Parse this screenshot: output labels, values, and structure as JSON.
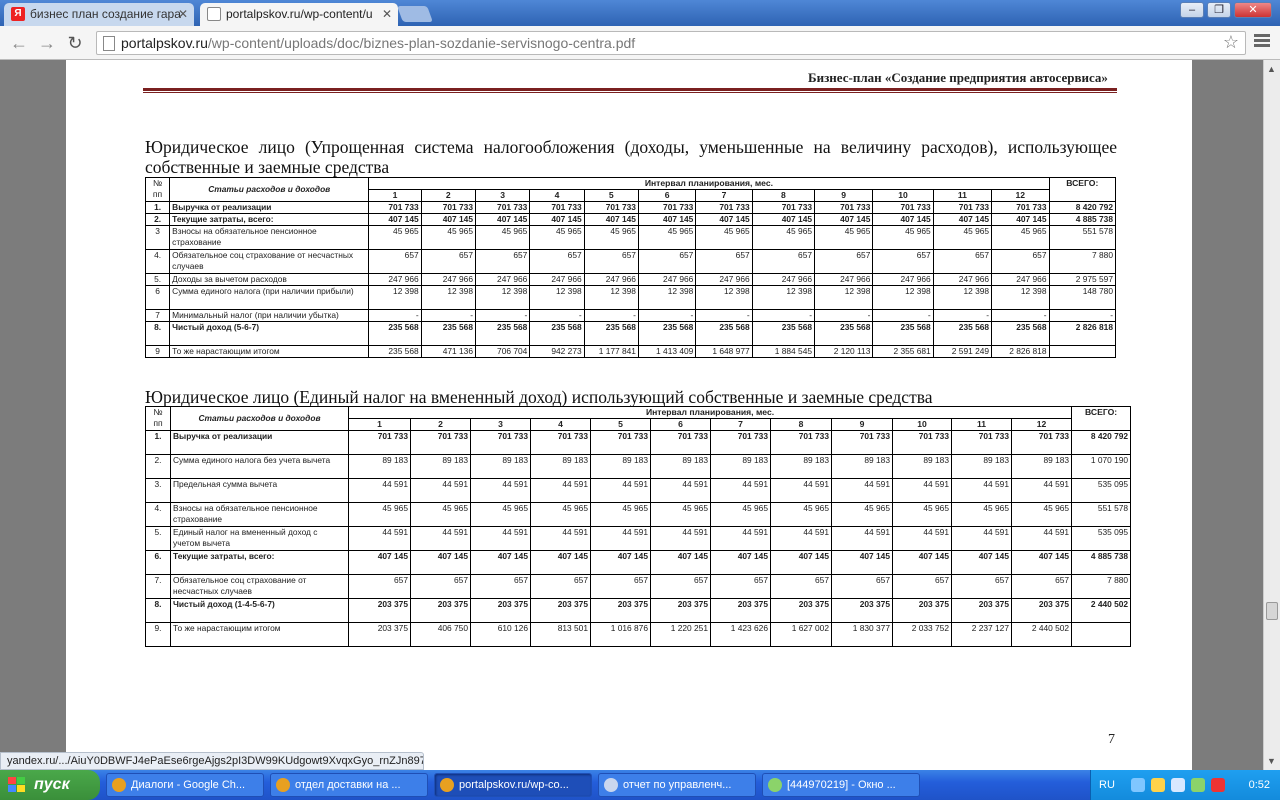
{
  "browser": {
    "tabs": [
      {
        "title": "бизнес план создание гара",
        "favicon": "Я",
        "active": false
      },
      {
        "title": "portalpskov.ru/wp-content/u",
        "favicon": "",
        "active": true
      }
    ],
    "url_host": "portalpskov.ru",
    "url_path": "/wp-content/uploads/doc/biznes-plan-sozdanie-servisnogo-centra.pdf",
    "status_text": "yandex.ru/.../AiuY0DBWFJ4ePaEse6rgeAjgs2pI3DW99KUdgowt9XvqxGyo_rnZJn897..."
  },
  "doc": {
    "header": "Бизнес-план «Создание предприятия автосервиса»",
    "page_number": "7",
    "section1_title": "Юридическое лицо (Упрощенная система налогообложения (доходы, уменьшенные на величину расходов), использующее собственные и заемные средства",
    "section2_title": "Юридическое лицо (Единый налог на вмененный доход) использующий собственные и заемные средства",
    "head": {
      "no": "№ пп",
      "items": "Статьи расходов и доходов",
      "interval": "Интервал планирования, мес.",
      "total": "ВСЕГО:",
      "months": [
        "1",
        "2",
        "3",
        "4",
        "5",
        "6",
        "7",
        "8",
        "9",
        "10",
        "11",
        "12"
      ]
    },
    "table1": [
      {
        "n": "1.",
        "label": "Выручка от реализации",
        "bold": true,
        "v": [
          "701 733",
          "701 733",
          "701 733",
          "701 733",
          "701 733",
          "701 733",
          "701 733",
          "701 733",
          "701 733",
          "701 733",
          "701 733",
          "701 733"
        ],
        "t": "8 420 792"
      },
      {
        "n": "2.",
        "label": "Текущие затраты, всего:",
        "bold": true,
        "v": [
          "407 145",
          "407 145",
          "407 145",
          "407 145",
          "407 145",
          "407 145",
          "407 145",
          "407 145",
          "407 145",
          "407 145",
          "407 145",
          "407 145"
        ],
        "t": "4 885 738"
      },
      {
        "n": "3",
        "label": "Взносы на обязательное пенсионное страхование",
        "bold": false,
        "v": [
          "45 965",
          "45 965",
          "45 965",
          "45 965",
          "45 965",
          "45 965",
          "45 965",
          "45 965",
          "45 965",
          "45 965",
          "45 965",
          "45 965"
        ],
        "t": "551 578"
      },
      {
        "n": "4.",
        "label": "Обязательное соц страхование от несчастных случаев",
        "bold": false,
        "v": [
          "657",
          "657",
          "657",
          "657",
          "657",
          "657",
          "657",
          "657",
          "657",
          "657",
          "657",
          "657"
        ],
        "t": "7 880"
      },
      {
        "n": "5.",
        "label": "Доходы за вычетом расходов",
        "bold": false,
        "v": [
          "247 966",
          "247 966",
          "247 966",
          "247 966",
          "247 966",
          "247 966",
          "247 966",
          "247 966",
          "247 966",
          "247 966",
          "247 966",
          "247 966"
        ],
        "t": "2 975 597"
      },
      {
        "n": "6",
        "label": "Сумма единого налога (при наличии прибыли)",
        "bold": false,
        "v": [
          "12 398",
          "12 398",
          "12 398",
          "12 398",
          "12 398",
          "12 398",
          "12 398",
          "12 398",
          "12 398",
          "12 398",
          "12 398",
          "12 398"
        ],
        "t": "148 780"
      },
      {
        "n": "7",
        "label": "Минимальный налог (при наличии убытка)",
        "bold": false,
        "v": [
          "-",
          "-",
          "-",
          "-",
          "-",
          "-",
          "-",
          "-",
          "-",
          "-",
          "-",
          "-"
        ],
        "t": "-"
      },
      {
        "n": "8.",
        "label": "Чистый доход (5-6-7)",
        "bold": true,
        "v": [
          "235 568",
          "235 568",
          "235 568",
          "235 568",
          "235 568",
          "235 568",
          "235 568",
          "235 568",
          "235 568",
          "235 568",
          "235 568",
          "235 568"
        ],
        "t": "2 826 818"
      },
      {
        "n": "9",
        "label": "То же нарастающим итогом",
        "bold": false,
        "v": [
          "235 568",
          "471 136",
          "706 704",
          "942 273",
          "1 177 841",
          "1 413 409",
          "1 648 977",
          "1 884 545",
          "2 120 113",
          "2 355 681",
          "2 591 249",
          "2 826 818"
        ],
        "t": ""
      }
    ],
    "table2": [
      {
        "n": "1.",
        "label": "Выручка от реализации",
        "bold": true,
        "v": [
          "701 733",
          "701 733",
          "701 733",
          "701 733",
          "701 733",
          "701 733",
          "701 733",
          "701 733",
          "701 733",
          "701 733",
          "701 733",
          "701 733"
        ],
        "t": "8 420 792"
      },
      {
        "n": "2.",
        "label": "Сумма единого налога без учета вычета",
        "bold": false,
        "v": [
          "89 183",
          "89 183",
          "89 183",
          "89 183",
          "89 183",
          "89 183",
          "89 183",
          "89 183",
          "89 183",
          "89 183",
          "89 183",
          "89 183"
        ],
        "t": "1 070 190"
      },
      {
        "n": "3.",
        "label": "Предельная сумма вычета",
        "bold": false,
        "v": [
          "44 591",
          "44 591",
          "44 591",
          "44 591",
          "44 591",
          "44 591",
          "44 591",
          "44 591",
          "44 591",
          "44 591",
          "44 591",
          "44 591"
        ],
        "t": "535 095"
      },
      {
        "n": "4.",
        "label": "Взносы на обязательное пенсионное страхование",
        "bold": false,
        "v": [
          "45 965",
          "45 965",
          "45 965",
          "45 965",
          "45 965",
          "45 965",
          "45 965",
          "45 965",
          "45 965",
          "45 965",
          "45 965",
          "45 965"
        ],
        "t": "551 578"
      },
      {
        "n": "5.",
        "label": "Единый налог на вмененный доход с учетом вычета",
        "bold": false,
        "v": [
          "44 591",
          "44 591",
          "44 591",
          "44 591",
          "44 591",
          "44 591",
          "44 591",
          "44 591",
          "44 591",
          "44 591",
          "44 591",
          "44 591"
        ],
        "t": "535 095"
      },
      {
        "n": "6.",
        "label": "Текущие затраты, всего:",
        "bold": true,
        "v": [
          "407 145",
          "407 145",
          "407 145",
          "407 145",
          "407 145",
          "407 145",
          "407 145",
          "407 145",
          "407 145",
          "407 145",
          "407 145",
          "407 145"
        ],
        "t": "4 885 738"
      },
      {
        "n": "7.",
        "label": "Обязательное соц страхование от несчастных случаев",
        "bold": false,
        "v": [
          "657",
          "657",
          "657",
          "657",
          "657",
          "657",
          "657",
          "657",
          "657",
          "657",
          "657",
          "657"
        ],
        "t": "7 880"
      },
      {
        "n": "8.",
        "label": "Чистый доход (1-4-5-6-7)",
        "bold": true,
        "v": [
          "203 375",
          "203 375",
          "203 375",
          "203 375",
          "203 375",
          "203 375",
          "203 375",
          "203 375",
          "203 375",
          "203 375",
          "203 375",
          "203 375"
        ],
        "t": "2 440 502"
      },
      {
        "n": "9.",
        "label": "То же нарастающим итогом",
        "bold": false,
        "v": [
          "203 375",
          "406 750",
          "610 126",
          "813 501",
          "1 016 876",
          "1 220 251",
          "1 423 626",
          "1 627 002",
          "1 830 377",
          "2 033 752",
          "2 237 127",
          "2 440 502"
        ],
        "t": ""
      }
    ]
  },
  "taskbar": {
    "start_label": "пуск",
    "items": [
      {
        "label": "Диалоги - Google Ch...",
        "active": false,
        "color": "#e8a020"
      },
      {
        "label": "отдел доставки на ...",
        "active": false,
        "color": "#e8a020"
      },
      {
        "label": "portalpskov.ru/wp-co...",
        "active": true,
        "color": "#e8a020"
      },
      {
        "label": "отчет по управленч...",
        "active": false,
        "color": "#c9d6ee"
      },
      {
        "label": "[444970219] - Окно ...",
        "active": false,
        "color": "#8bd36a"
      }
    ],
    "lang": "RU",
    "clock": "0:52"
  }
}
